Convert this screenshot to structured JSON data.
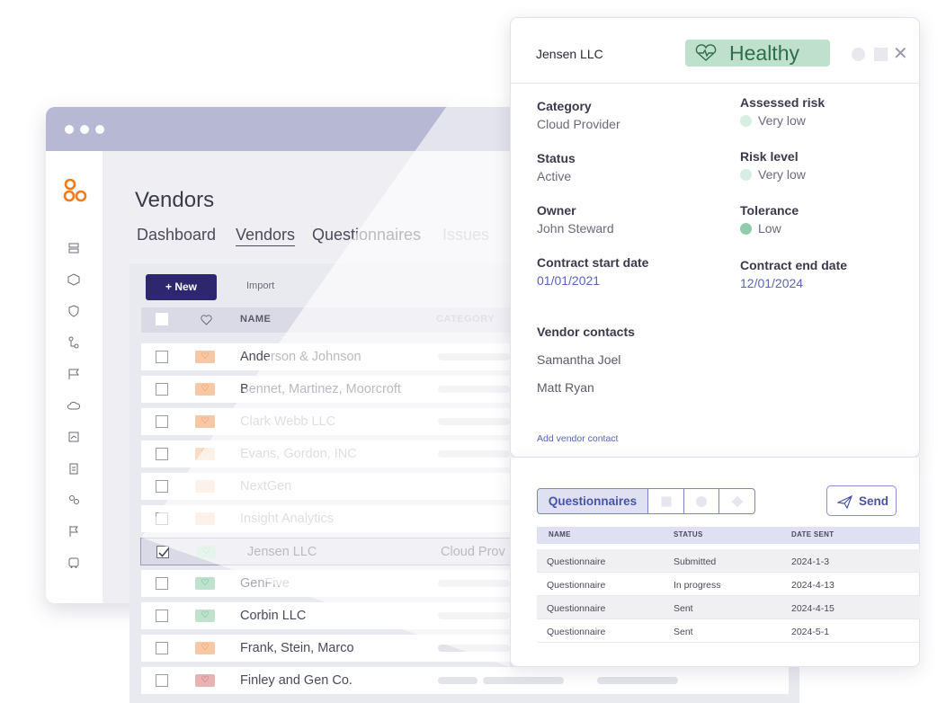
{
  "app": {
    "page_title": "Vendors",
    "tabs": [
      {
        "label": "Dashboard"
      },
      {
        "label": "Vendors"
      },
      {
        "label": "Questionnaires"
      },
      {
        "label": "Issues"
      }
    ],
    "toolbar": {
      "new_label": "+ New",
      "import_label": "Import"
    },
    "table_headers": {
      "name": "NAME",
      "category": "CATEGORY"
    },
    "rows": [
      {
        "name": "Anderson & Johnson",
        "health": "orange"
      },
      {
        "name": "Bennet, Martinez, Moorcroft",
        "health": "orange"
      },
      {
        "name": "Clark Webb LLC",
        "health": "orange"
      },
      {
        "name": "Evans, Gordon, INC",
        "health": "orange"
      },
      {
        "name": "NextGen",
        "health": "orange"
      },
      {
        "name": "Insight Analytics",
        "health": "orange"
      },
      {
        "name": "Jensen LLC",
        "category": "Cloud Prov",
        "health": "green",
        "selected": true
      },
      {
        "name": "GenFive",
        "health": "green"
      },
      {
        "name": "Corbin LLC",
        "health": "green"
      },
      {
        "name": "Frank, Stein, Marco",
        "health": "orange"
      },
      {
        "name": "Finley and Gen Co.",
        "health": "red"
      }
    ]
  },
  "detail": {
    "vendor_name": "Jensen LLC",
    "health_status": "Healthy",
    "fields": {
      "category": {
        "label": "Category",
        "value": "Cloud Provider"
      },
      "status": {
        "label": "Status",
        "value": "Active"
      },
      "owner": {
        "label": "Owner",
        "value": "John Steward"
      },
      "contract_start": {
        "label": "Contract start date",
        "value": "01/01/2021"
      },
      "assessed_risk": {
        "label": "Assessed risk",
        "value": "Very low"
      },
      "risk_level": {
        "label": "Risk level",
        "value": "Very low"
      },
      "tolerance": {
        "label": "Tolerance",
        "value": "Low"
      },
      "contract_end": {
        "label": "Contract end date",
        "value": "12/01/2024"
      }
    },
    "contacts_label": "Vendor contacts",
    "contacts": [
      "Samantha Joel",
      "Matt Ryan"
    ],
    "add_contact_label": "Add vendor contact"
  },
  "questionnaires": {
    "tab_label": "Questionnaires",
    "send_label": "Send",
    "headers": {
      "name": "NAME",
      "status": "STATUS",
      "date_sent": "DATE SENT"
    },
    "rows": [
      {
        "name": "Questionnaire",
        "status": "Submitted",
        "date_sent": "2024-1-3"
      },
      {
        "name": "Questionnaire",
        "status": "In progress",
        "date_sent": "2024-4-13"
      },
      {
        "name": "Questionnaire",
        "status": "Sent",
        "date_sent": "2024-4-15"
      },
      {
        "name": "Questionnaire",
        "status": "Sent",
        "date_sent": "2024-5-1"
      }
    ]
  },
  "colors": {
    "primary": "#2e2770",
    "healthy_bg": "#bfe0cd",
    "healthy_text": "#2f6e4a",
    "link": "#5a64b8",
    "very_low_dot": "#d7efe3",
    "low_dot": "#8fcbac"
  },
  "icons": {
    "logo": "three-circles-logo",
    "sidebar": [
      "server-icon",
      "box-icon",
      "shield-icon",
      "workflow-icon",
      "flag-chat-icon",
      "cloud-icon",
      "report-icon",
      "clipboard-icon",
      "vendors-icon",
      "flag-icon",
      "bus-icon"
    ]
  }
}
